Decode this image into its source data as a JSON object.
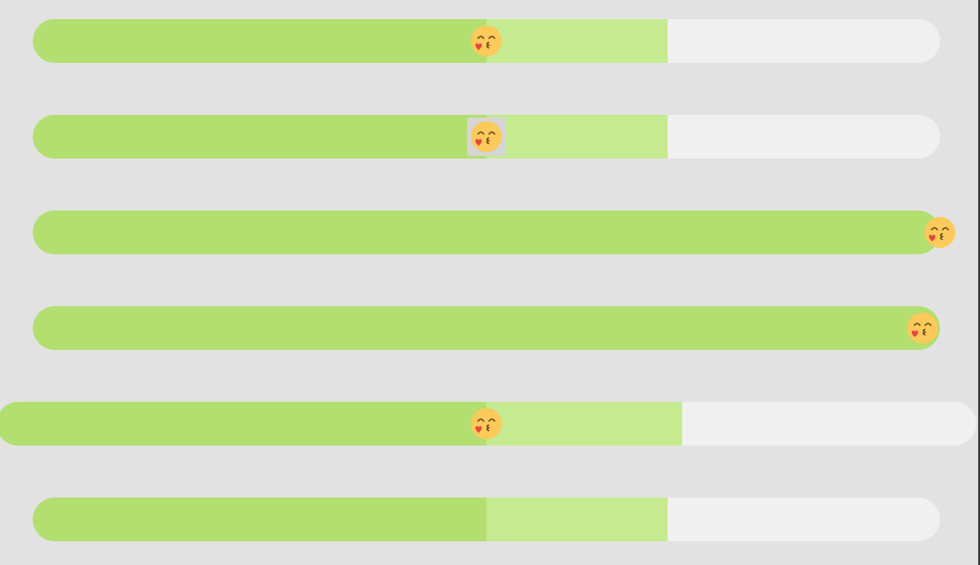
{
  "colors": {
    "page_background": "#e2e2e2",
    "progress": "#b2df70",
    "buffer": "#c6ea90",
    "track": "#f0f0f0",
    "face": "#fbca5a",
    "heart": "#e8453c",
    "eye": "#6b4a1e"
  },
  "thumb_icon": "kissing-face-with-heart-icon",
  "sliders": [
    {
      "id": "slider-1",
      "progress": 0.5,
      "buffer": 0.7,
      "thumb": true,
      "focused": false
    },
    {
      "id": "slider-2",
      "progress": 0.5,
      "buffer": 0.7,
      "thumb": true,
      "focused": true
    },
    {
      "id": "slider-3",
      "progress": 1.0,
      "buffer": 1.0,
      "thumb": true,
      "focused": false
    },
    {
      "id": "slider-4",
      "progress": 1.0,
      "buffer": 1.0,
      "thumb": true,
      "focused": false,
      "thumb_inset": true
    },
    {
      "id": "slider-5",
      "progress": 0.5,
      "buffer": 0.7,
      "thumb": true,
      "focused": false
    },
    {
      "id": "slider-6",
      "progress": 0.5,
      "buffer": 0.7,
      "thumb": false,
      "focused": false
    }
  ]
}
